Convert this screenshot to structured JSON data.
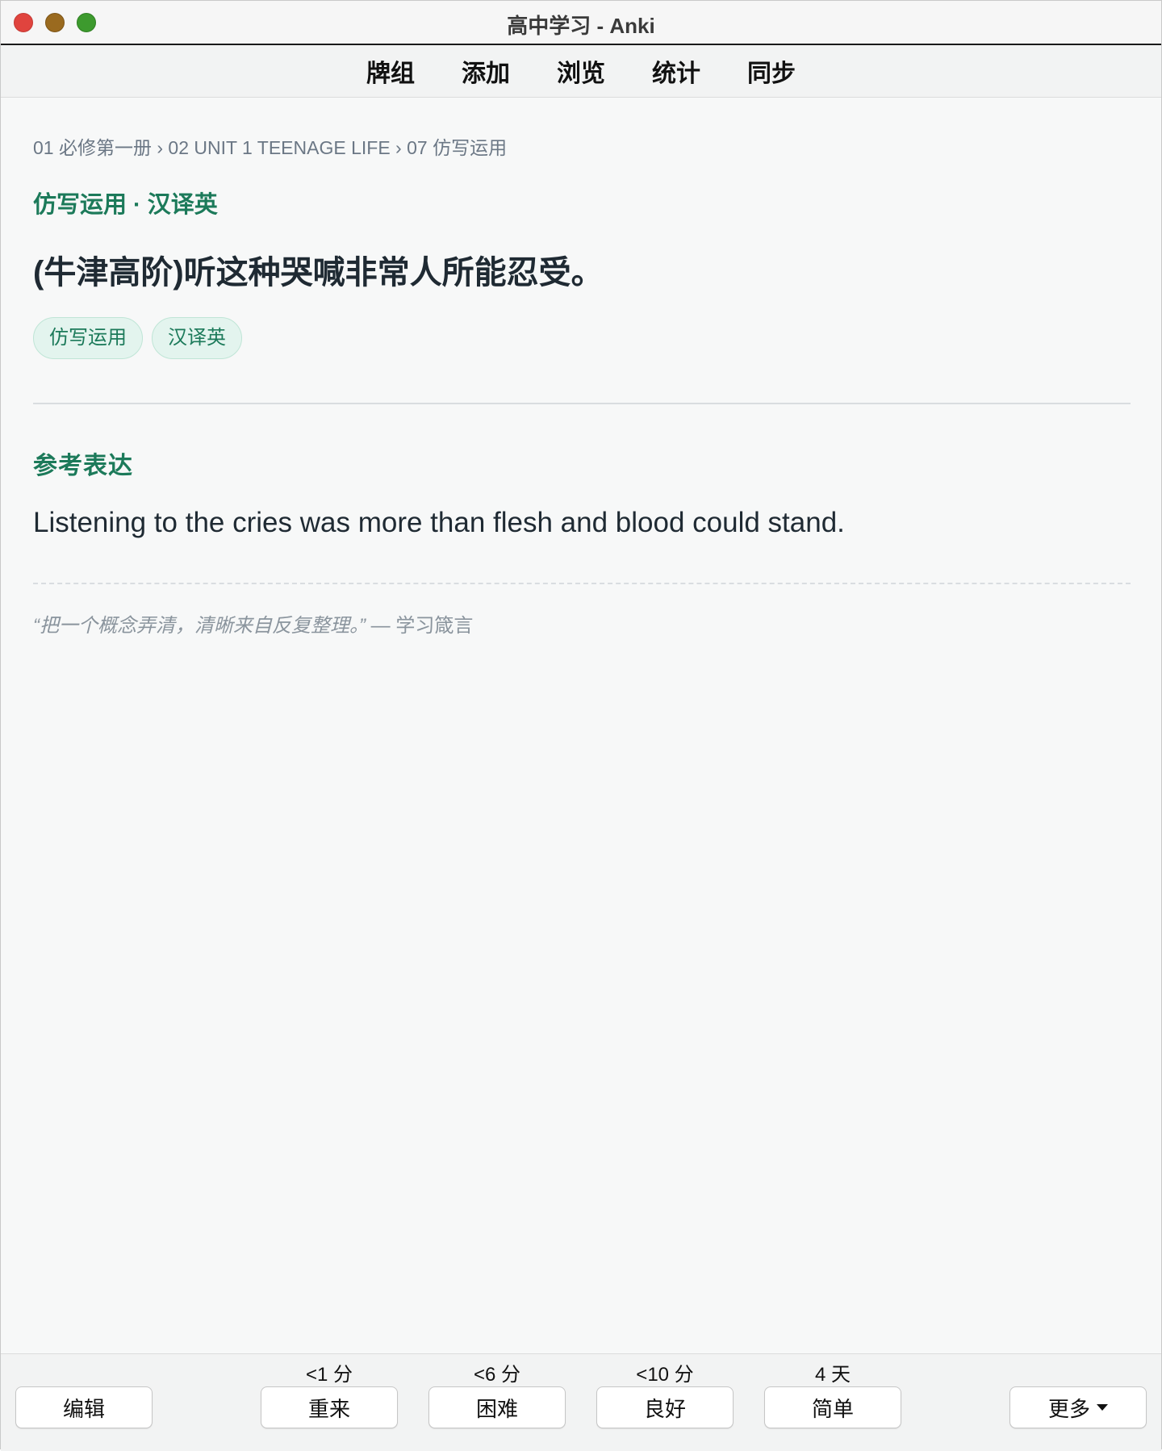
{
  "window": {
    "title": "高中学习 - Anki"
  },
  "toolbar": {
    "items": [
      "牌组",
      "添加",
      "浏览",
      "统计",
      "同步"
    ]
  },
  "card": {
    "breadcrumb": "01 必修第一册 › 02 UNIT 1 TEENAGE LIFE › 07 仿写运用",
    "type": "仿写运用 · 汉译英",
    "question": "(牛津高阶)听这种哭喊非常人所能忍受。",
    "tags": [
      "仿写运用",
      "汉译英"
    ],
    "answer_heading": "参考表达",
    "answer": "Listening to the cries was more than flesh and blood could stand.",
    "quote_text": "“把一个概念弄清，清晰来自反复整理。”",
    "quote_source": "— 学习箴言"
  },
  "bottom": {
    "edit_label": "编辑",
    "more_label": "更多",
    "answers": [
      {
        "interval": "<1 分",
        "label": "重来"
      },
      {
        "interval": "<6 分",
        "label": "困难"
      },
      {
        "interval": "<10 分",
        "label": "良好"
      },
      {
        "interval": "4 天",
        "label": "简单"
      }
    ]
  },
  "colors": {
    "accent": "#1c7a5a",
    "tag_bg": "#e3f4ee",
    "text": "#1f2a33",
    "muted": "#6b7785"
  }
}
